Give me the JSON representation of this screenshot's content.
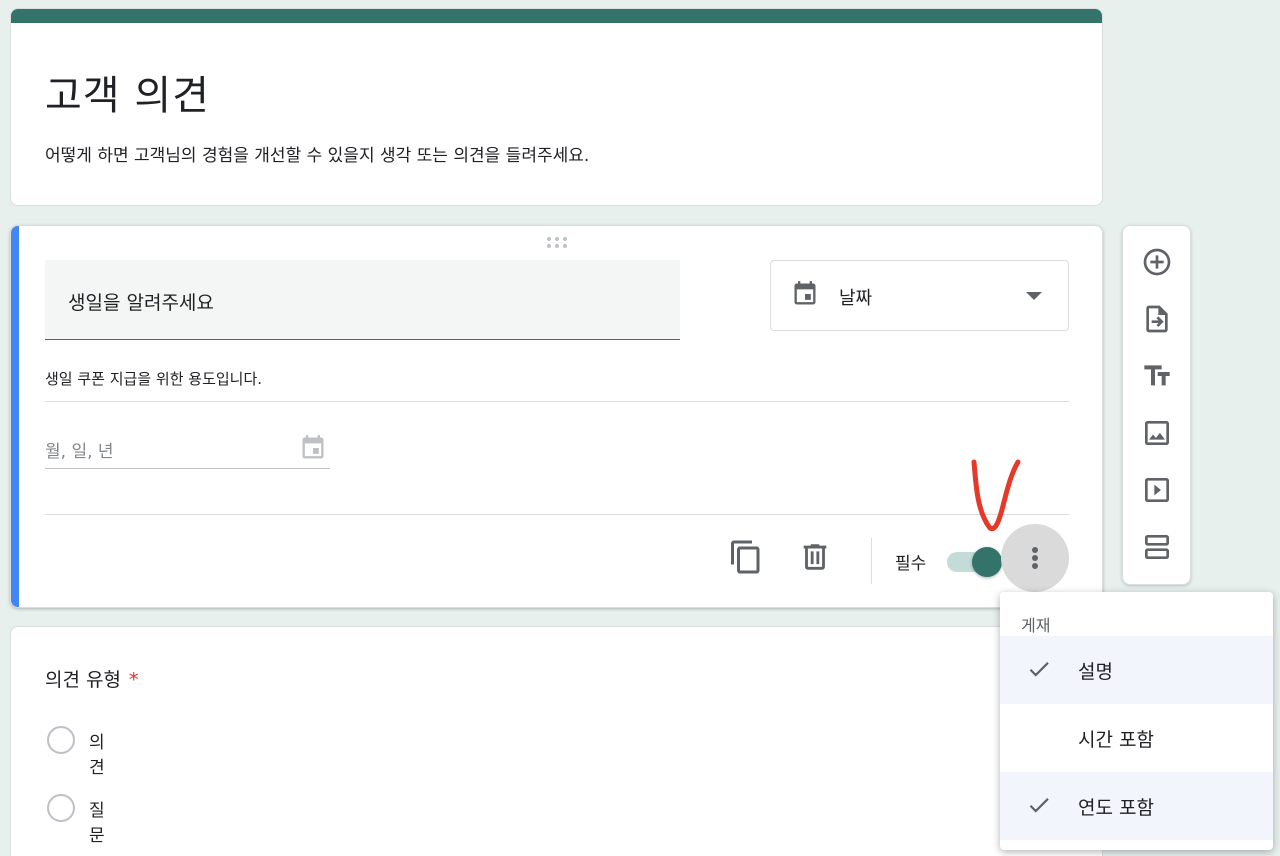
{
  "header": {
    "title": "고객 의견",
    "description": "어떻게 하면 고객님의 경험을 개선할 수 있을지 생각 또는 의견을 들려주세요."
  },
  "question": {
    "title": "생일을 알려주세요",
    "type_label": "날짜",
    "description": "생일 쿠폰 지급을 위한 용도입니다.",
    "date_placeholder": "월, 일, 년",
    "required_label": "필수",
    "required": true
  },
  "question2": {
    "title": "의견 유형",
    "required_mark": "*",
    "options": [
      "의견",
      "질문"
    ]
  },
  "menu": {
    "header": "게재",
    "items": [
      {
        "label": "설명",
        "checked": true
      },
      {
        "label": "시간 포함",
        "checked": false
      },
      {
        "label": "연도 포함",
        "checked": true
      }
    ]
  },
  "toolbar": {
    "icons": [
      "add-question-icon",
      "import-questions-icon",
      "add-title-icon",
      "add-image-icon",
      "add-video-icon",
      "add-section-icon"
    ]
  },
  "colors": {
    "theme": "#33736a",
    "accent_bar": "#4285f4",
    "background": "#e8f0ee",
    "annotation": "#e53a2a"
  }
}
